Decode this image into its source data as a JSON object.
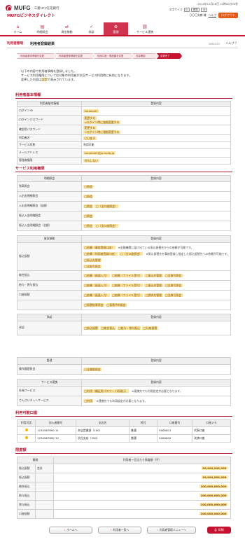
{
  "header": {
    "logo": "MUFG",
    "bank": "三菱UFJ信託銀行",
    "service": "MUFGビジネスダイレクト",
    "login_time": "2014年11月18日 10時00分00秒",
    "font_size_label": "文字サイズ",
    "font_small": "小",
    "font_std": "標準",
    "font_large": "大",
    "user": "〇〇〇太郎 様",
    "help": "ヘルプ",
    "logout": "ログアウト"
  },
  "nav": [
    {
      "label": "ホーム",
      "icon": "⌂"
    },
    {
      "label": "明細照会",
      "icon": "▤"
    },
    {
      "label": "資金移動",
      "icon": "⇄"
    },
    {
      "label": "承認",
      "icon": "✓"
    },
    {
      "label": "管理",
      "icon": "⚙"
    },
    {
      "label": "サービス連携",
      "icon": "⛓"
    }
  ],
  "page": {
    "category": "利用者管理",
    "title": "利用者登録結果",
    "screen_id": "BKKU015",
    "help": "ヘルプ"
  },
  "steps": [
    "利用者基本情報を変更",
    "利用者登録情報を変更",
    "利用口座・限度額を変更",
    "内容確認",
    "変更完了"
  ],
  "message": [
    "以下の内容で利用者情報を登録しました。",
    "サービス利用権限については対象の利用者が次回サービス利用時に有効になります。",
    "変更した内容は",
    "で表示されています。"
  ],
  "message_highlight": "太字",
  "basic": {
    "section": "利用者基本情報",
    "col_item": "利用者基本情報",
    "col_value": "登録内容",
    "rows": [
      {
        "label": "ログインID",
        "value": "hanako01",
        "tag": true
      },
      {
        "label": "ログインパスワード",
        "value": "変更する",
        "note": "→ログイン時に強制変更する",
        "tag": true
      },
      {
        "label": "確認用パスワード",
        "value": "変更する",
        "note": "→ログイン時に強制変更する",
        "tag": true
      },
      {
        "label": "利用者名",
        "value": "〇〇花子",
        "tag": true
      },
      {
        "label": "サービス状態",
        "value": "利用可能",
        "tag": false
      },
      {
        "label": "メールアドレス",
        "value": "hanako01@jp.mufg.jp",
        "tag": true
      },
      {
        "label": "管理者権限",
        "value": "付与しない",
        "tag": true
      }
    ]
  },
  "svc": {
    "section": "サービス利用権限",
    "t1_col1": "明細照会",
    "t1_col2": "登録内容",
    "t1_rows": [
      {
        "label": "残高照会",
        "v": [
          "□照会"
        ]
      },
      {
        "label": "入出金明細照会",
        "v": [
          "□照会"
        ]
      },
      {
        "label": "入出金明細照会（全銀）",
        "v": [
          "□照会",
          "□（全口座照会）"
        ]
      },
      {
        "label": "振込入金明細照会",
        "v": [
          "□照会"
        ]
      },
      {
        "label": "振込入金明細照会（全銀）",
        "v": [
          "□照会",
          "□（全口座照会）"
        ]
      }
    ],
    "t2_col1": "資金移動",
    "t2_col2": "登録内容",
    "furikomi_label": "振込振替",
    "furikomi_lines": [
      {
        "v": [
          "□依頼（事前登録口座）"
        ],
        "note": "※金融機関に届け出ている振込振替先からの依頼が可能です。"
      },
      {
        "v": [
          "□依頼（利用者登録口座）",
          "□（全口座照会）"
        ],
        "note": "※振込振替先を事前登録し指定した振込振替先への依頼が可能です。"
      },
      {
        "v": [
          "□振込先管理"
        ]
      },
      {
        "v": [
          "□全取引照会"
        ]
      }
    ],
    "t2_rows": [
      {
        "label": "総合振込",
        "v": [
          "□依頼（画面入力）",
          "□依頼（ファイル受付）",
          "□振込先管理",
          "□全取引照会"
        ]
      },
      {
        "label": "給与・賞与振込",
        "v": [
          "□依頼（画面入力）",
          "□依頼（ファイル受付）",
          "□振込先管理",
          "□全取引照会"
        ]
      },
      {
        "label": "口座振替",
        "v": [
          "□依頼（画面入力）",
          "□依頼（ファイル受付）",
          "□請求先管理",
          "□全取引照会"
        ]
      },
      {
        "label": "",
        "v": [
          "□振替結果照会",
          "□振替予約照会"
        ]
      }
    ],
    "t3_col1": "承認",
    "t3_col2": "登録内容",
    "t3_rows": [
      {
        "label": "承認",
        "v": [
          "□振込振替",
          "□総合振込",
          "□給与・賞与振込",
          "□口座振替"
        ]
      }
    ],
    "t4_col1": "管理",
    "t4_col2": "登録内容",
    "t4_rows": [
      {
        "label": "操作履歴照会",
        "v": [
          "□全履歴照会"
        ]
      }
    ],
    "t5_col1": "サービス連携",
    "t5_col2": "登録内容",
    "t5_rows": [
      {
        "label": "外為サービス",
        "v": [
          "□利用（補足用パスワード再発行）"
        ],
        "note": "※連携先でも利用設定が必要となります。"
      },
      {
        "label": "でんさいネットサービス",
        "v": [
          "□利用"
        ],
        "note": "※連携先でも利用設定が必要となります。"
      }
    ]
  },
  "accounts": {
    "section": "利用可能口座",
    "cols": [
      "利用可否",
      "加入者番号",
      "支店名",
      "科目",
      "口座番号",
      "口座メモ"
    ],
    "rows": [
      {
        "no": "1234567890 11",
        "branch": "本店営業部（100）",
        "kind": "普通",
        "acct": "5000001",
        "memo": "代表口座"
      },
      {
        "no": "1234567890 12",
        "branch": "渋谷支店（550）",
        "kind": "普通",
        "acct": "5000002",
        "memo": "決済口座"
      }
    ]
  },
  "limits": {
    "section": "限度額",
    "col1": "業務",
    "col2": "利用者一回当たり限度額（円）",
    "rows": [
      {
        "label": "振込振替",
        "sub": "合計",
        "value": "99,999,999,999"
      },
      {
        "label": "振込振替",
        "sub": "",
        "value": "99,999,999,999"
      },
      {
        "label": "総合振込",
        "sub": "",
        "value": "100,000,000,000"
      },
      {
        "label": "給与振込",
        "sub": "",
        "value": "100,000,000,000"
      },
      {
        "label": "賞与振込",
        "sub": "",
        "value": "100,000,000,000"
      },
      {
        "label": "口座振替",
        "sub": "",
        "value": "100,000,000,000"
      }
    ]
  },
  "buttons": {
    "home": "ホームへ",
    "list": "利用者一覧へ",
    "menu": "利用者管理メニューへ",
    "print": "印刷"
  }
}
